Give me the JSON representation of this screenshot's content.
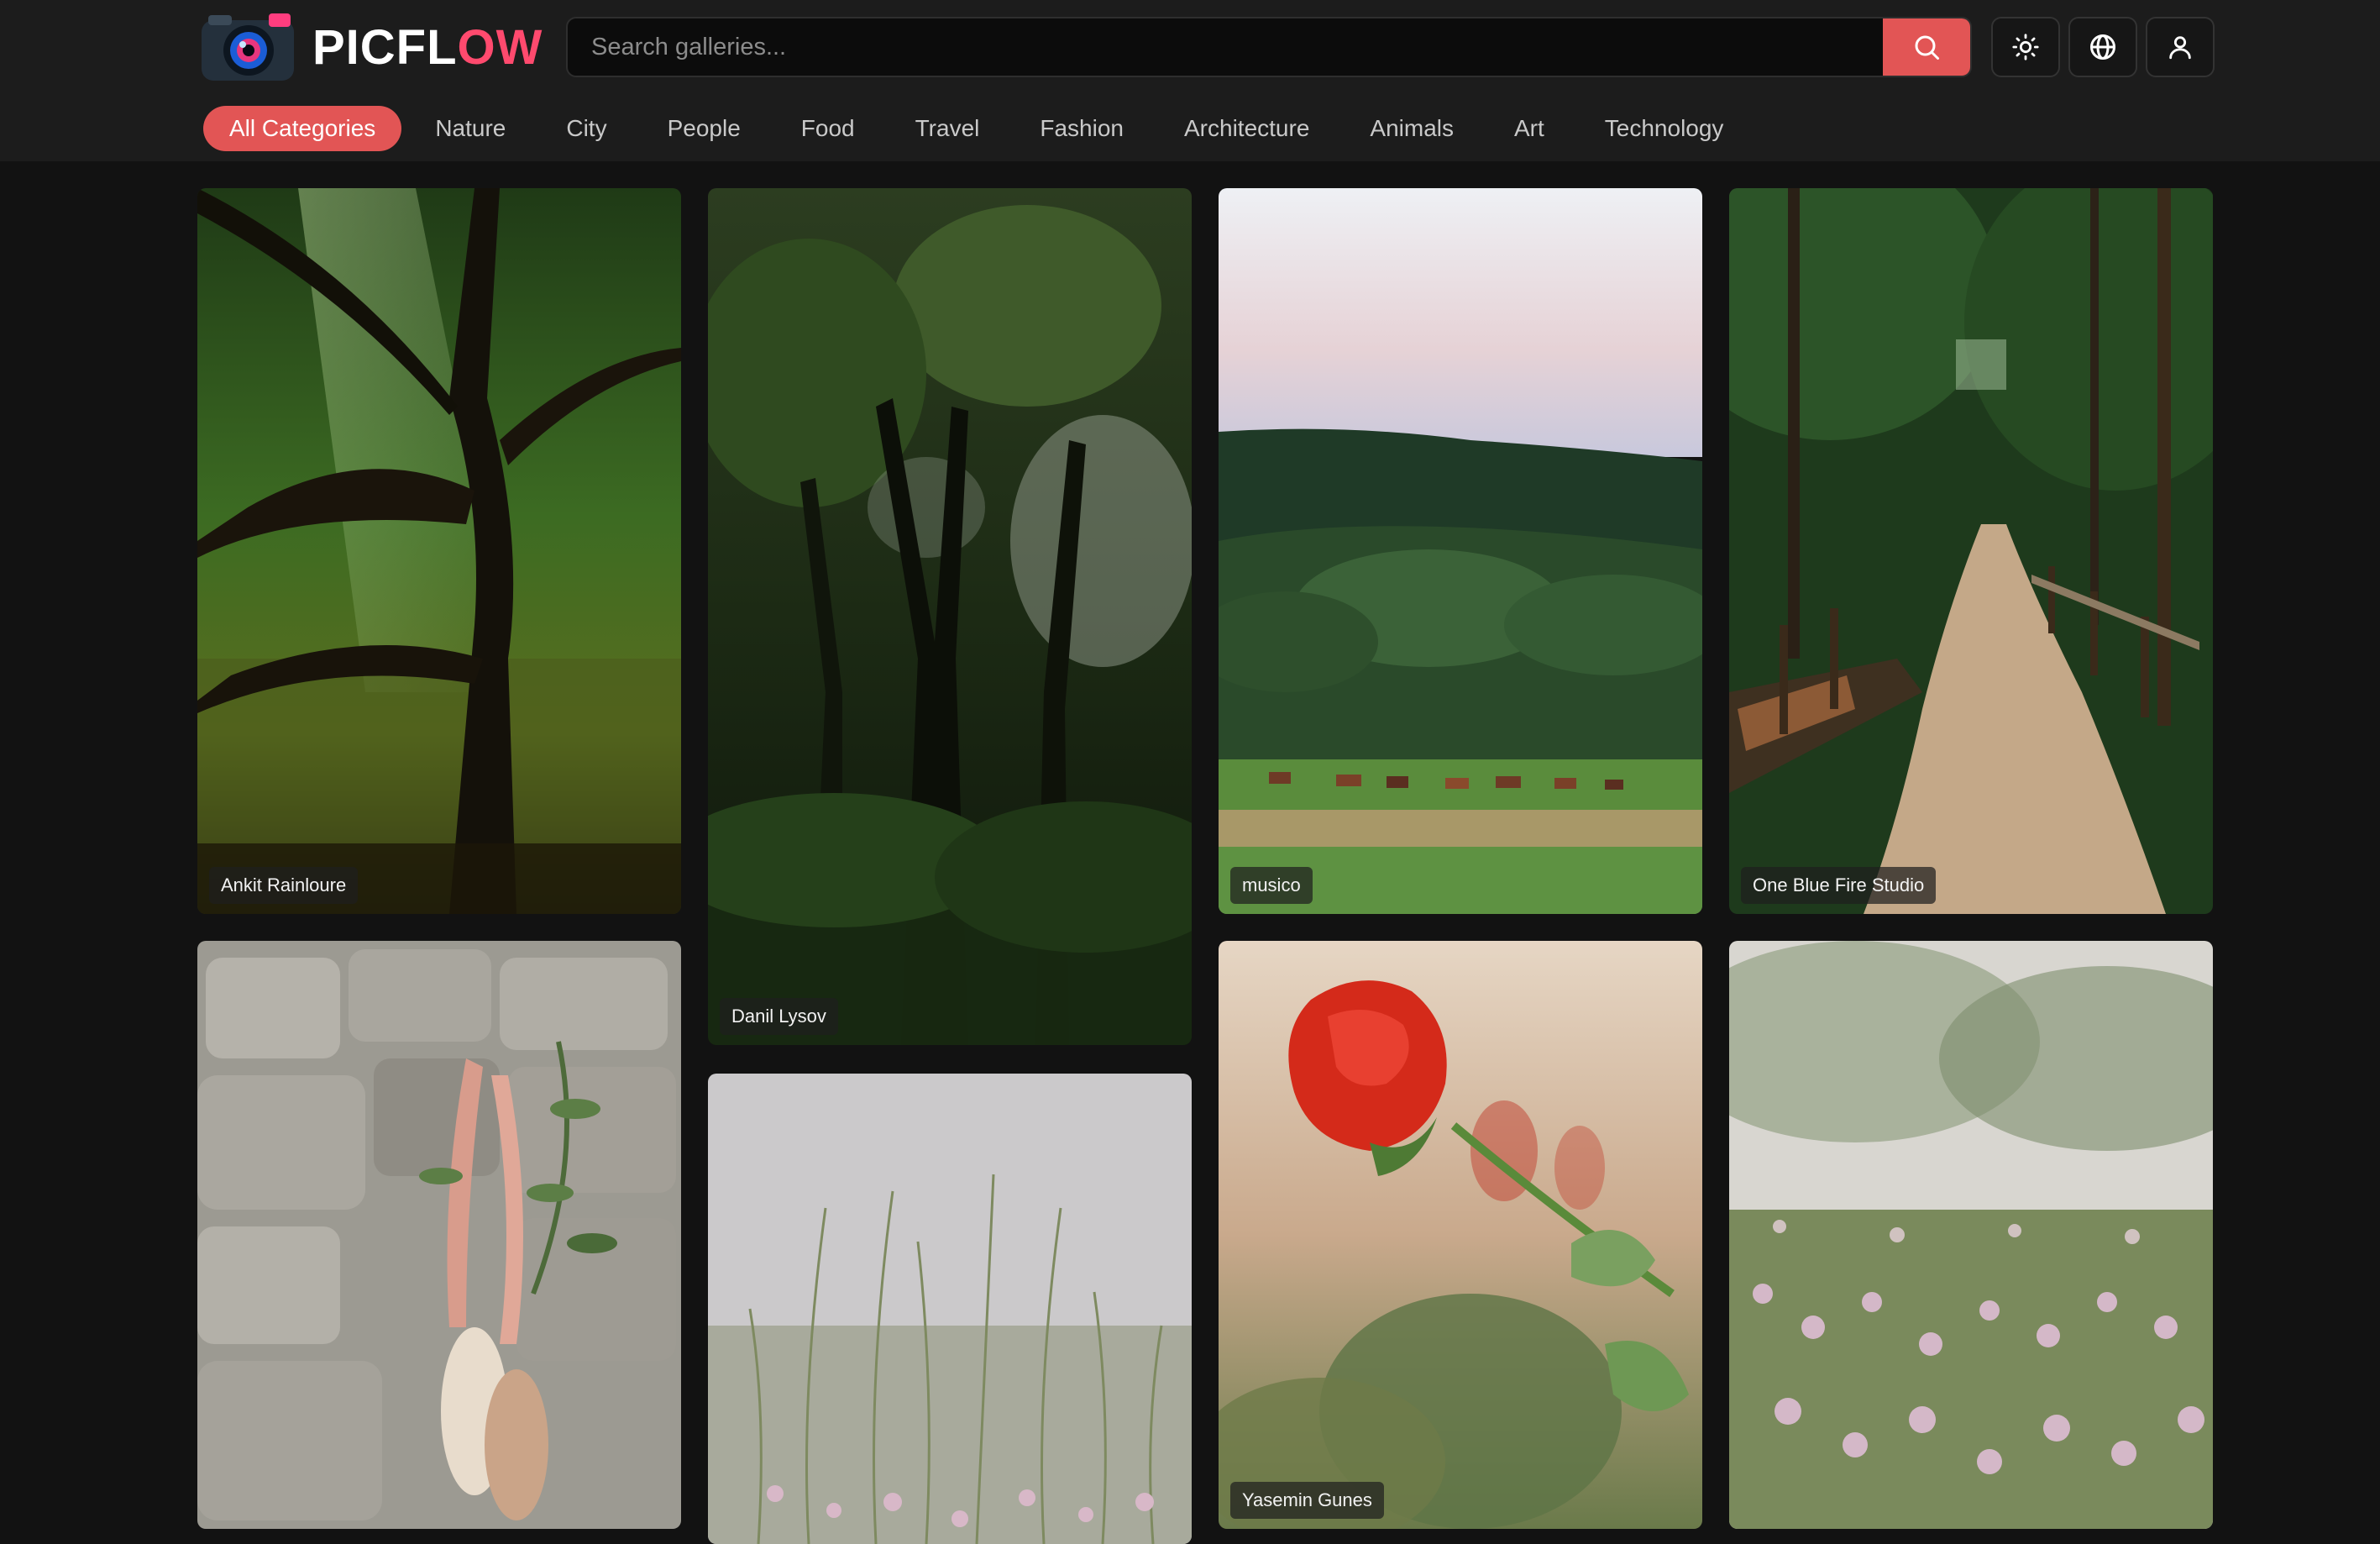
{
  "app": {
    "brand_main": "PICFL",
    "brand_accent": "OW",
    "accent_color": "#e25555"
  },
  "search": {
    "placeholder": "Search galleries...",
    "value": ""
  },
  "header_icons": [
    "sun-icon",
    "globe-icon",
    "user-icon"
  ],
  "categories": [
    "All Categories",
    "Nature",
    "City",
    "People",
    "Food",
    "Travel",
    "Fashion",
    "Architecture",
    "Animals",
    "Art",
    "Technology"
  ],
  "active_category": "All Categories",
  "gallery": {
    "photos": [
      {
        "author": "Ankit Rainloure",
        "subject": "forest-light"
      },
      {
        "author": "Danil Lysov",
        "subject": "dense-trees"
      },
      {
        "author": "musico",
        "subject": "meadow-cows"
      },
      {
        "author": "One Blue Fire Studio",
        "subject": "forest-path"
      },
      {
        "author": "",
        "subject": "ballet-shoes-stone-wall"
      },
      {
        "author": "",
        "subject": "grass-field"
      },
      {
        "author": "Yasemin Gunes",
        "subject": "red-rose"
      },
      {
        "author": "",
        "subject": "pink-wildflowers"
      }
    ]
  }
}
